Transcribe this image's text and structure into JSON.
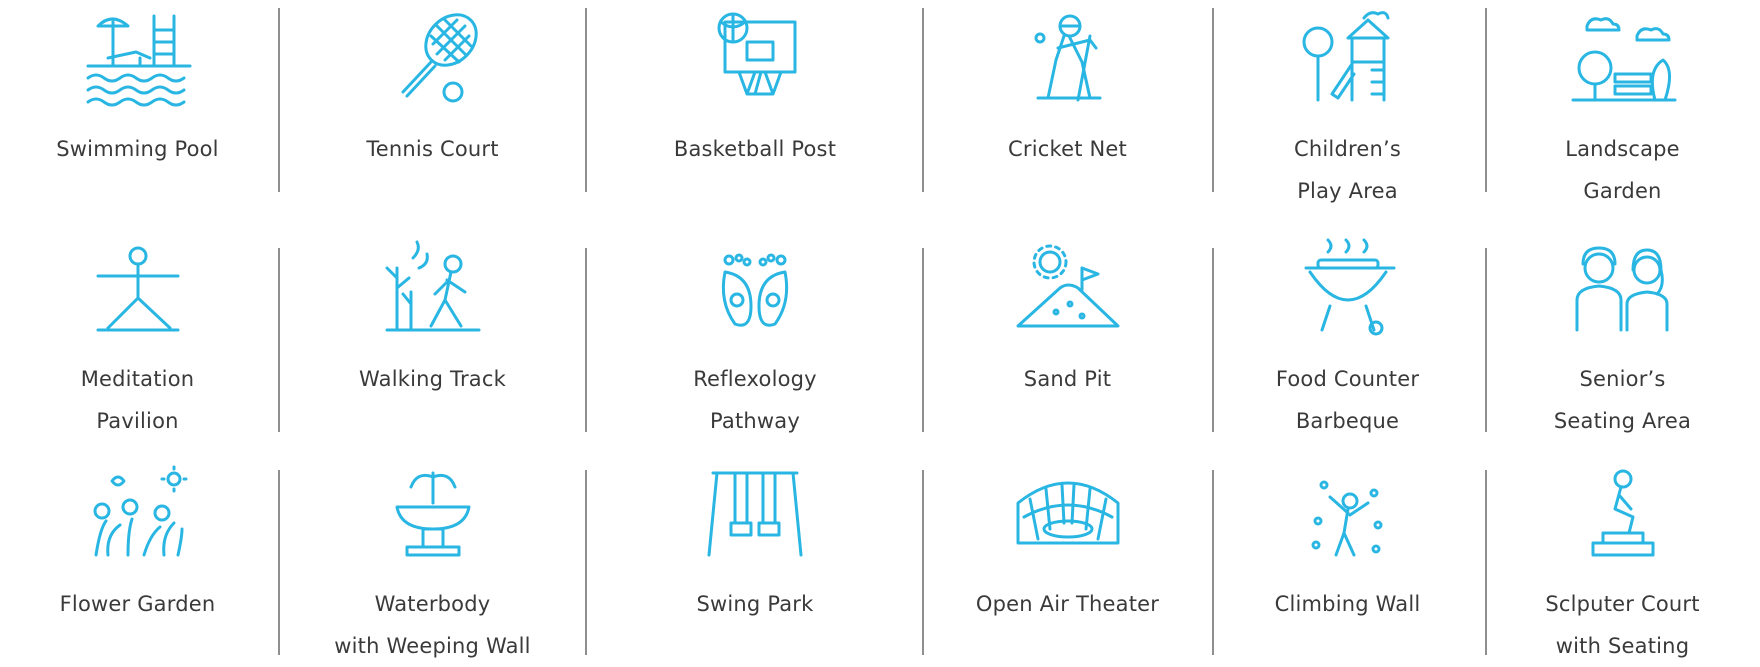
{
  "accent_color": "#29b6e3",
  "rows": [
    [
      {
        "icon": "swimming-pool-icon",
        "lines": [
          "Swimming Pool"
        ]
      },
      {
        "icon": "tennis-racket-icon",
        "lines": [
          "Tennis Court"
        ]
      },
      {
        "icon": "basketball-hoop-icon",
        "lines": [
          "Basketball Post"
        ]
      },
      {
        "icon": "cricket-player-icon",
        "lines": [
          "Cricket Net"
        ]
      },
      {
        "icon": "playground-slide-icon",
        "lines": [
          "Children’s",
          "Play Area"
        ]
      },
      {
        "icon": "landscape-garden-icon",
        "lines": [
          "Landscape",
          "Garden"
        ]
      }
    ],
    [
      {
        "icon": "yoga-pose-icon",
        "lines": [
          "Meditation",
          "Pavilion"
        ]
      },
      {
        "icon": "walking-person-icon",
        "lines": [
          "Walking Track"
        ]
      },
      {
        "icon": "footprints-icon",
        "lines": [
          "Reflexology",
          "Pathway"
        ]
      },
      {
        "icon": "sand-pit-icon",
        "lines": [
          "Sand Pit"
        ]
      },
      {
        "icon": "barbeque-grill-icon",
        "lines": [
          "Food Counter",
          "Barbeque"
        ]
      },
      {
        "icon": "senior-couple-icon",
        "lines": [
          "Senior’s",
          "Seating Area"
        ]
      }
    ],
    [
      {
        "icon": "flower-garden-icon",
        "lines": [
          "Flower Garden"
        ]
      },
      {
        "icon": "fountain-icon",
        "lines": [
          "Waterbody",
          "with Weeping Wall"
        ]
      },
      {
        "icon": "swing-icon",
        "lines": [
          "Swing Park"
        ]
      },
      {
        "icon": "amphitheater-icon",
        "lines": [
          "Open Air Theater"
        ]
      },
      {
        "icon": "climbing-wall-icon",
        "lines": [
          "Climbing Wall"
        ]
      },
      {
        "icon": "sculpture-icon",
        "lines": [
          "Sclputer Court",
          "with Seating"
        ]
      }
    ]
  ]
}
